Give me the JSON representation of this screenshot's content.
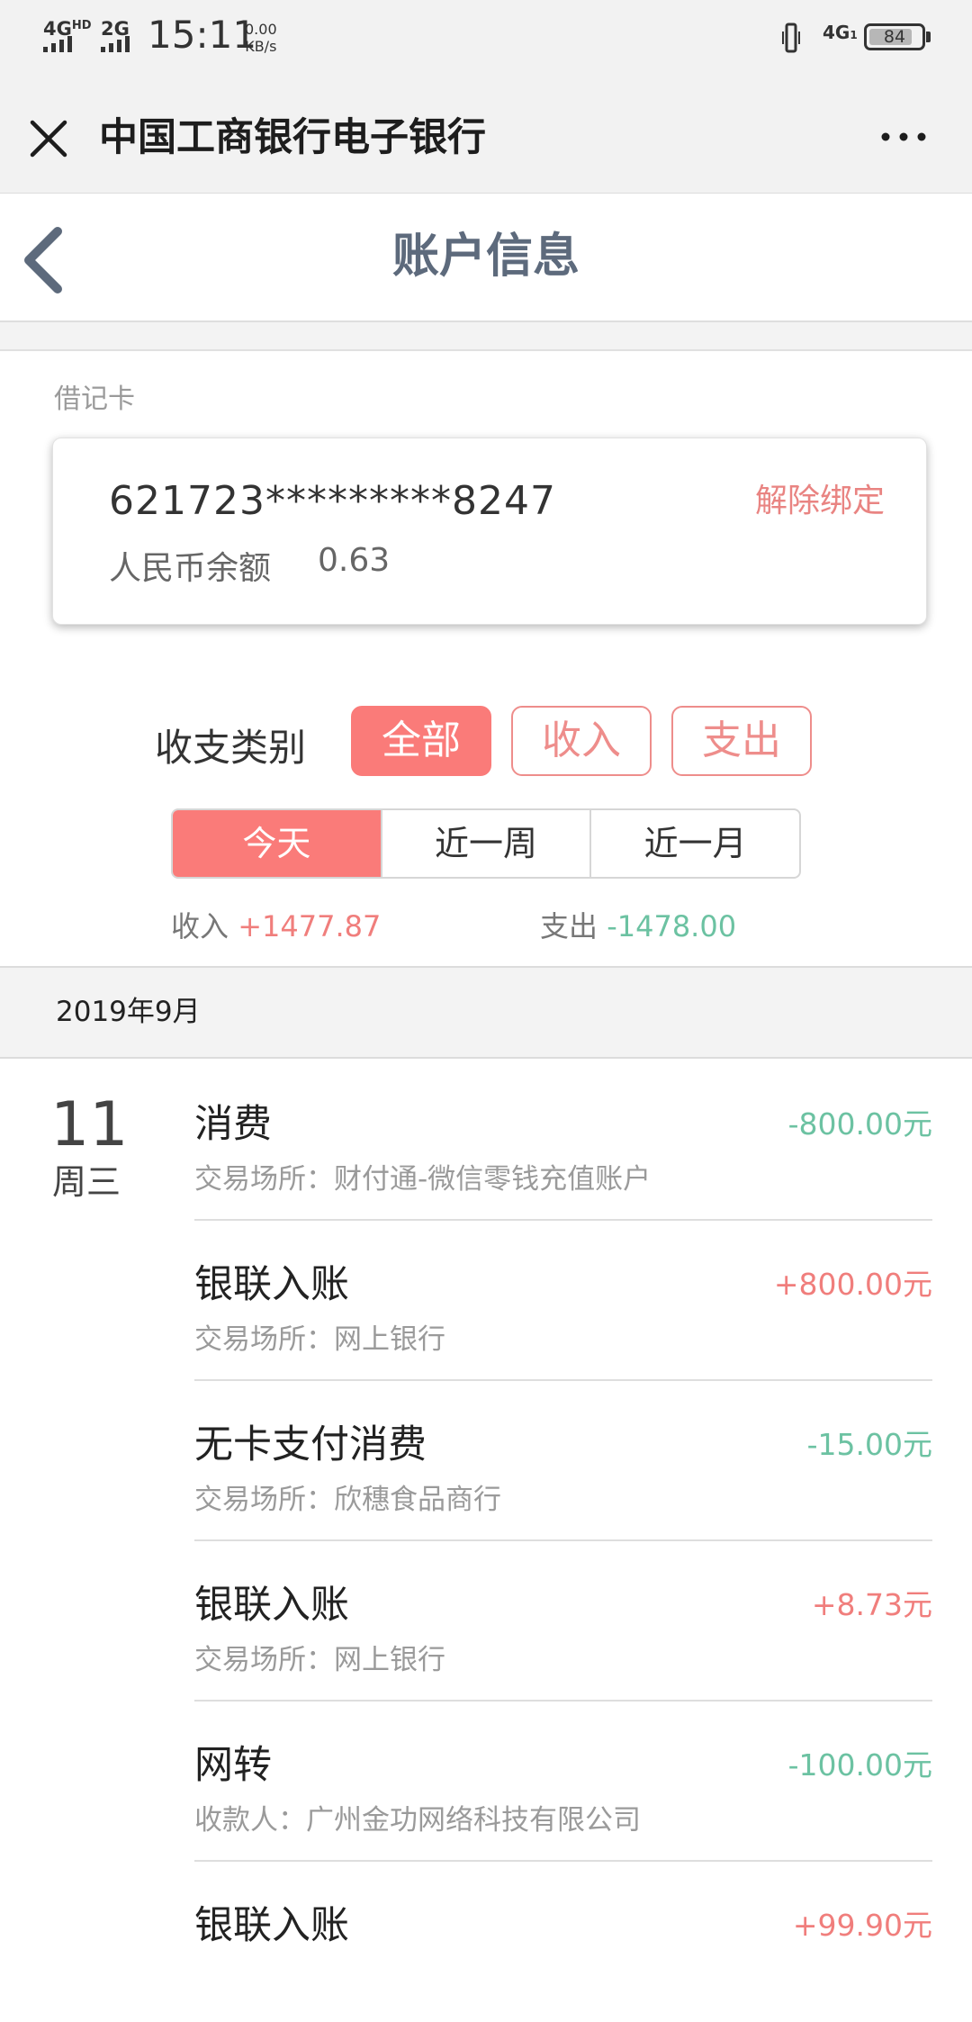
{
  "status_bar": {
    "network1": "4G",
    "network1_sup": "HD",
    "network2": "2G",
    "time": "15:11",
    "speed_value": "0.00",
    "speed_unit": "KB/s",
    "network3": "4G",
    "network3_sub": "1",
    "battery": "84"
  },
  "titlebar": {
    "title": "中国工商银行电子银行",
    "close_icon": "close-icon",
    "more_icon": "more-icon"
  },
  "header": {
    "title": "账户信息",
    "back_icon": "chevron-left-icon"
  },
  "card": {
    "type_label": "借记卡",
    "number": "621723*********8247",
    "balance_label": "人民币余额",
    "balance": "0.63",
    "unbind_label": "解除绑定"
  },
  "filter": {
    "label": "收支类别",
    "options": [
      {
        "label": "全部",
        "active": true
      },
      {
        "label": "收入",
        "active": false
      },
      {
        "label": "支出",
        "active": false
      }
    ]
  },
  "period": {
    "options": [
      {
        "label": "今天",
        "active": true
      },
      {
        "label": "近一周",
        "active": false
      },
      {
        "label": "近一月",
        "active": false
      }
    ]
  },
  "summary": {
    "income_label": "收入",
    "income_value": "+1477.87",
    "expense_label": "支出",
    "expense_value": "-1478.00"
  },
  "month": "2019年9月",
  "day": {
    "date": "11",
    "weekday": "周三"
  },
  "transactions": [
    {
      "title": "消费",
      "detail": "交易场所：财付通-微信零钱充值账户",
      "amount": "-800.00元",
      "type": "out"
    },
    {
      "title": "银联入账",
      "detail": "交易场所：网上银行",
      "amount": "+800.00元",
      "type": "in"
    },
    {
      "title": "无卡支付消费",
      "detail": "交易场所：欣穗食品商行",
      "amount": "-15.00元",
      "type": "out"
    },
    {
      "title": "银联入账",
      "detail": "交易场所：网上银行",
      "amount": "+8.73元",
      "type": "in"
    },
    {
      "title": "网转",
      "detail": "收款人：广州金功网络科技有限公司",
      "amount": "-100.00元",
      "type": "out"
    },
    {
      "title": "银联入账",
      "detail": "",
      "amount": "+99.90元",
      "type": "in"
    }
  ],
  "colors": {
    "accent_red": "#fa7b79",
    "income_red": "#f07e7c",
    "expense_green": "#6cc2a2",
    "header_text": "#5d6a7c"
  }
}
